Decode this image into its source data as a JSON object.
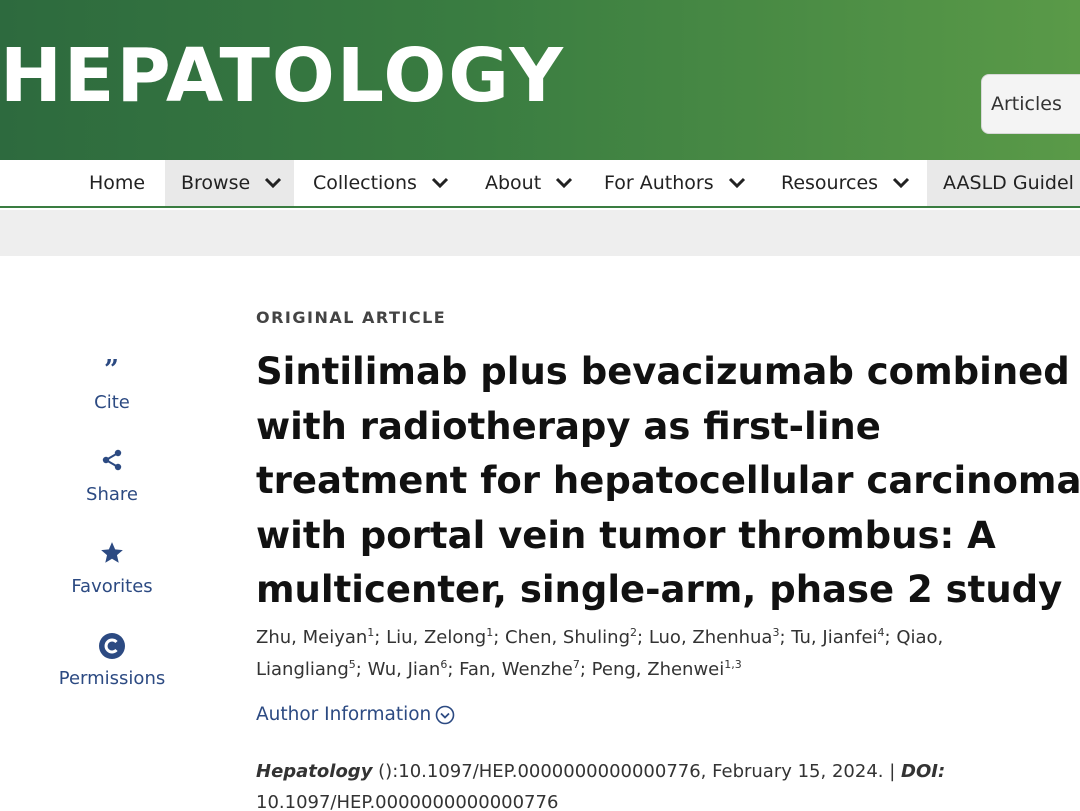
{
  "header": {
    "logo": "HEPATOLOGY",
    "search_button": "Articles"
  },
  "nav": {
    "items": [
      {
        "label": "Home"
      },
      {
        "label": "Browse"
      },
      {
        "label": "Collections"
      },
      {
        "label": "About"
      },
      {
        "label": "For Authors"
      },
      {
        "label": "Resources"
      },
      {
        "label": "AASLD Guidel"
      }
    ]
  },
  "tools": [
    {
      "label": "Cite",
      "icon": "quote-icon"
    },
    {
      "label": "Share",
      "icon": "share-icon"
    },
    {
      "label": "Favorites",
      "icon": "star-icon"
    },
    {
      "label": "Permissions",
      "icon": "copyright-icon"
    }
  ],
  "article": {
    "type": "ORIGINAL ARTICLE",
    "title_lines": [
      "Sintilimab plus bevacizumab combined",
      "with radiotherapy as first-line",
      "treatment for hepatocellular carcinoma",
      "with portal vein tumor thrombus: A",
      "multicenter, single-arm, phase 2 study"
    ],
    "authors": [
      {
        "name": "Zhu, Meiyan",
        "aff": "1"
      },
      {
        "name": "Liu, Zelong",
        "aff": "1"
      },
      {
        "name": "Chen, Shuling",
        "aff": "2"
      },
      {
        "name": "Luo, Zhenhua",
        "aff": "3"
      },
      {
        "name": "Tu, Jianfei",
        "aff": "4"
      },
      {
        "name": "Qiao, Liangliang",
        "aff": "5"
      },
      {
        "name": "Wu, Jian",
        "aff": "6"
      },
      {
        "name": "Fan, Wenzhe",
        "aff": "7"
      },
      {
        "name": "Peng, Zhenwei",
        "aff": "1,3"
      }
    ],
    "author_info_label": "Author Information",
    "citation": {
      "journal": "Hepatology",
      "ref": " ():10.1097/HEP.0000000000000776, February 15, 2024. | ",
      "doi_label": "DOI:",
      "doi": "10.1097/HEP.0000000000000776"
    }
  },
  "colors": {
    "banner_start": "#2d6a3e",
    "banner_end": "#5a9a48",
    "link": "#2c4a82"
  }
}
